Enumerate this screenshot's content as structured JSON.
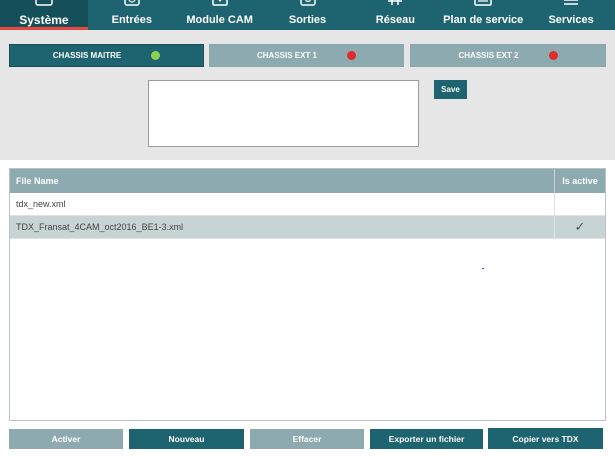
{
  "nav": {
    "items": [
      {
        "label": "Système",
        "icon": "system-icon"
      },
      {
        "label": "Entrées",
        "icon": "inputs-icon"
      },
      {
        "label": "Module CAM",
        "icon": "cam-module-icon"
      },
      {
        "label": "Sorties",
        "icon": "outputs-icon"
      },
      {
        "label": "Réseau",
        "icon": "network-icon"
      },
      {
        "label": "Plan de service",
        "icon": "service-plan-icon"
      },
      {
        "label": "Services",
        "icon": "services-icon"
      }
    ],
    "active_index": 0
  },
  "chassis": {
    "tabs": [
      {
        "label": "CHASSIS MAITRE",
        "status_color": "#8fd14f",
        "active": true
      },
      {
        "label": "CHASSIS EXT 1",
        "status_color": "#e02b2b",
        "active": false
      },
      {
        "label": "CHASSIS EXT 2",
        "status_color": "#e02b2b",
        "active": false
      }
    ]
  },
  "editor": {
    "save_label": "Save"
  },
  "table": {
    "columns": [
      "File Name",
      "Is active"
    ],
    "rows": [
      {
        "name": "tdx_new.xml",
        "active": ""
      },
      {
        "name": "TDX_Fransat_4CAM_oct2016_BE1-3.xml",
        "active": "✓"
      }
    ],
    "selected_index": 1
  },
  "actions": {
    "activer": "Activer",
    "nouveau": "Nouveau",
    "effacer": "Effacer",
    "exporter": "Exporter un fichier",
    "copier": "Copier vers TDX"
  },
  "colors": {
    "primary": "#1d6470",
    "muted": "#8eaab1",
    "accent_underline": "#e8453c"
  }
}
